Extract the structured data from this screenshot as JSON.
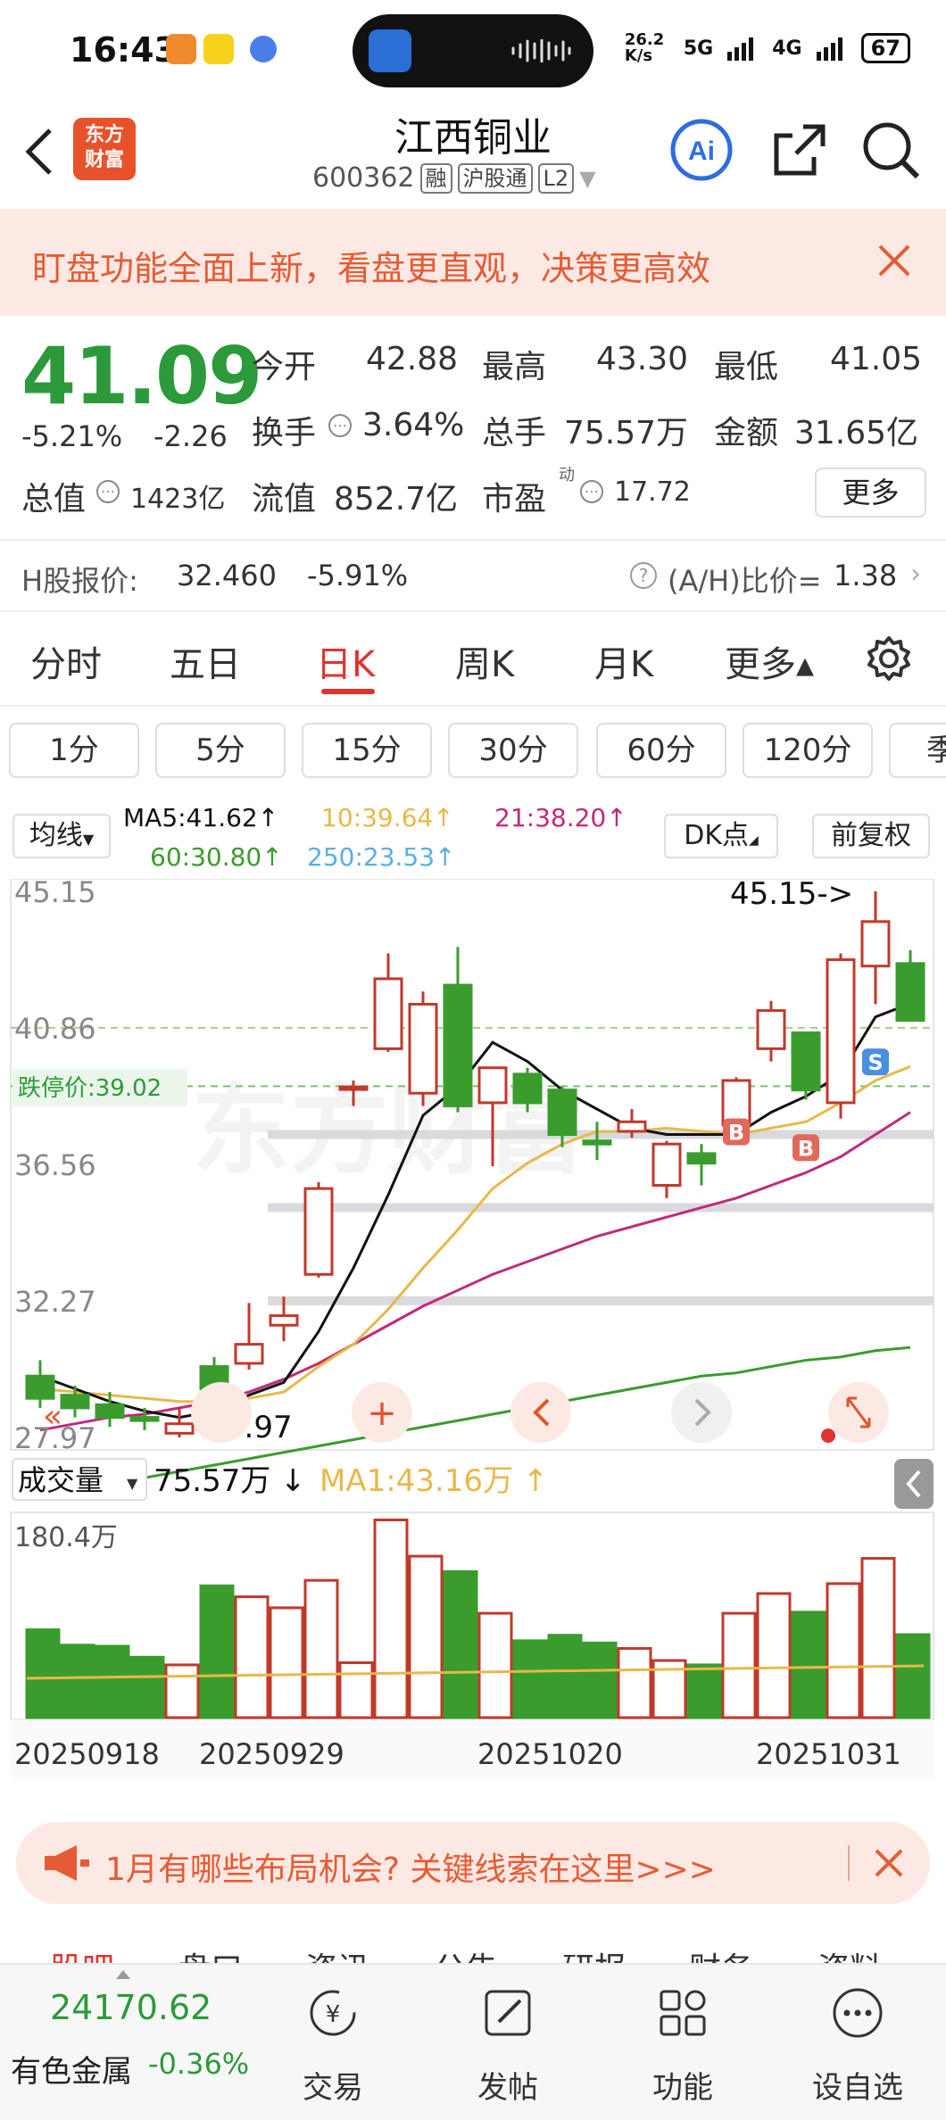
{
  "status_bar": {
    "time": "16:43",
    "net_speed": "26.2 K/s",
    "net1": "5G",
    "net2": "4G",
    "battery": "67"
  },
  "header": {
    "name": "江西铜业",
    "code": "600362",
    "tag1": "融",
    "tag2": "沪股通",
    "tag3": "L2",
    "logo_text": "东方财富"
  },
  "banner": {
    "text": "盯盘功能全面上新，看盘更直观，决策更高效"
  },
  "quote": {
    "price": "41.09",
    "change_pct": "-5.21%",
    "change": "-2.26",
    "open_label": "今开",
    "open": "42.88",
    "high_label": "最高",
    "high": "43.30",
    "low_label": "最低",
    "low": "41.05",
    "turnover_label": "换手",
    "turnover": "3.64%",
    "volume_label": "总手",
    "volume": "75.57万",
    "amount_label": "金额",
    "amount": "31.65亿",
    "mktcap_label": "总值",
    "mktcap": "1423亿",
    "float_label": "流值",
    "float": "852.7亿",
    "pe_label": "市盈",
    "pe_sup": "动",
    "pe": "17.72",
    "more": "更多"
  },
  "hshare": {
    "label": "H股报价:",
    "price": "32.460",
    "pct": "-5.91%",
    "ah_label": "(A/H)比价=",
    "ah": "1.38"
  },
  "tabs": [
    "分时",
    "五日",
    "日K",
    "周K",
    "月K",
    "更多▴"
  ],
  "periods": [
    "1分",
    "5分",
    "15分",
    "30分",
    "60分",
    "120分",
    "季"
  ],
  "indicators": {
    "ma_label": "均线",
    "ma5": "MA5:41.62↑",
    "ma10": "10:39.64↑",
    "ma21": "21:38.20↑",
    "ma60": "60:30.80↑",
    "ma250": "250:23.53↑",
    "dk": "DK点",
    "fq": "前复权"
  },
  "chart": {
    "y_labels": [
      "45.15",
      "40.86",
      "36.56",
      "32.27",
      "27.97"
    ],
    "limit_down_label": "跌停价:39.02",
    "high_marker": "45.15->",
    "low_marker": "-27.97",
    "markers": [
      "B",
      "B",
      "S"
    ],
    "vol_label": "成交量",
    "vol_value": "75.57万 ↓",
    "vol_ma": "MA1:43.16万 ↑",
    "vol_max": "180.4万",
    "dates": [
      "20250918",
      "20250929",
      "20251020",
      "20251031"
    ],
    "colors": {
      "up": "#c0392b",
      "down": "#3a9c2d",
      "ma5": "#111111",
      "ma10": "#e8b84a",
      "ma21": "#c02a7a",
      "ma60": "#3a9c2d"
    }
  },
  "chart_data": {
    "type": "candlestick",
    "candles": [
      {
        "o": 29.9,
        "c": 29.2,
        "h": 30.4,
        "l": 28.9,
        "v": 0.8
      },
      {
        "o": 29.3,
        "c": 28.9,
        "h": 29.6,
        "l": 28.6,
        "v": 0.66
      },
      {
        "o": 29.0,
        "c": 28.6,
        "h": 29.4,
        "l": 28.3,
        "v": 0.65
      },
      {
        "o": 28.6,
        "c": 28.5,
        "h": 28.9,
        "l": 28.2,
        "v": 0.55
      },
      {
        "o": 28.1,
        "c": 28.4,
        "h": 28.9,
        "l": 27.97,
        "v": 0.48
      },
      {
        "o": 30.2,
        "c": 29.5,
        "h": 30.5,
        "l": 29.1,
        "v": 1.2
      },
      {
        "o": 30.3,
        "c": 30.9,
        "h": 32.2,
        "l": 30.1,
        "v": 1.1
      },
      {
        "o": 31.5,
        "c": 31.8,
        "h": 32.4,
        "l": 31.0,
        "v": 1.0
      },
      {
        "o": 33.1,
        "c": 35.8,
        "h": 36.0,
        "l": 33.0,
        "v": 1.25
      },
      {
        "o": 39.0,
        "c": 39.0,
        "h": 39.2,
        "l": 38.4,
        "v": 0.5
      },
      {
        "o": 40.2,
        "c": 42.4,
        "h": 43.2,
        "l": 40.1,
        "v": 1.8
      },
      {
        "o": 38.8,
        "c": 41.6,
        "h": 42.0,
        "l": 38.4,
        "v": 1.47
      },
      {
        "o": 42.2,
        "c": 38.4,
        "h": 43.4,
        "l": 38.2,
        "v": 1.33
      },
      {
        "o": 38.5,
        "c": 39.6,
        "h": 39.6,
        "l": 36.5,
        "v": 0.95
      },
      {
        "o": 39.4,
        "c": 38.5,
        "h": 39.6,
        "l": 38.2,
        "v": 0.7
      },
      {
        "o": 38.9,
        "c": 37.5,
        "h": 39.0,
        "l": 37.1,
        "v": 0.75
      },
      {
        "o": 37.3,
        "c": 37.2,
        "h": 37.9,
        "l": 36.7,
        "v": 0.68
      },
      {
        "o": 37.6,
        "c": 37.9,
        "h": 38.3,
        "l": 37.4,
        "v": 0.63
      },
      {
        "o": 35.9,
        "c": 37.2,
        "h": 37.3,
        "l": 35.5,
        "v": 0.52
      },
      {
        "o": 36.9,
        "c": 36.6,
        "h": 37.2,
        "l": 35.9,
        "v": 0.48
      },
      {
        "o": 37.8,
        "c": 39.2,
        "h": 39.3,
        "l": 37.6,
        "v": 0.95
      },
      {
        "o": 40.2,
        "c": 41.4,
        "h": 41.7,
        "l": 39.8,
        "v": 1.13
      },
      {
        "o": 40.7,
        "c": 38.9,
        "h": 40.7,
        "l": 38.6,
        "v": 0.96
      },
      {
        "o": 38.5,
        "c": 43.0,
        "h": 43.2,
        "l": 38.0,
        "v": 1.22
      },
      {
        "o": 42.8,
        "c": 44.2,
        "h": 45.15,
        "l": 41.6,
        "v": 1.45
      },
      {
        "o": 42.88,
        "c": 41.09,
        "h": 43.3,
        "l": 41.05,
        "v": 0.7556
      }
    ],
    "ma5": [
      29.9,
      29.5,
      29.1,
      28.8,
      28.6,
      28.8,
      29.3,
      29.7,
      31.3,
      33.3,
      35.6,
      38.1,
      39.0,
      40.4,
      39.8,
      38.9,
      38.3,
      37.7,
      37.5,
      37.5,
      37.5,
      38.2,
      38.7,
      39.4,
      41.2,
      41.62
    ],
    "ma10": [
      29.5,
      29.4,
      29.3,
      29.2,
      29.1,
      29.1,
      29.2,
      29.4,
      30.2,
      30.9,
      32.0,
      33.3,
      34.5,
      35.8,
      36.6,
      37.2,
      37.6,
      37.6,
      37.7,
      37.6,
      37.5,
      37.7,
      37.9,
      38.5,
      39.2,
      39.64
    ],
    "ma21": [
      28.2,
      28.4,
      28.6,
      28.7,
      28.9,
      29.1,
      29.4,
      29.8,
      30.3,
      30.9,
      31.5,
      32.1,
      32.6,
      33.1,
      33.5,
      33.9,
      34.3,
      34.6,
      34.9,
      35.2,
      35.5,
      35.9,
      36.3,
      36.8,
      37.5,
      38.2
    ],
    "ma60": [
      26.1,
      26.3,
      26.5,
      26.7,
      26.9,
      27.1,
      27.3,
      27.5,
      27.7,
      27.9,
      28.1,
      28.3,
      28.5,
      28.7,
      28.9,
      29.1,
      29.3,
      29.5,
      29.7,
      29.9,
      30.0,
      30.2,
      30.4,
      30.5,
      30.7,
      30.8
    ],
    "y_range": [
      27.97,
      45.15
    ],
    "vol_range_wan": [
      0,
      180.4
    ]
  },
  "ad": {
    "text": "1月有哪些布局机会? 关键线索在这里>>>"
  },
  "subtabs": [
    "股吧",
    "盘口",
    "资讯",
    "公告",
    "研报",
    "财务",
    "资料"
  ],
  "bottom": {
    "index_value": "24170.62",
    "index_name": "有色金属",
    "index_pct": "-0.36%",
    "nav": [
      "交易",
      "发帖",
      "功能",
      "设自选"
    ]
  }
}
